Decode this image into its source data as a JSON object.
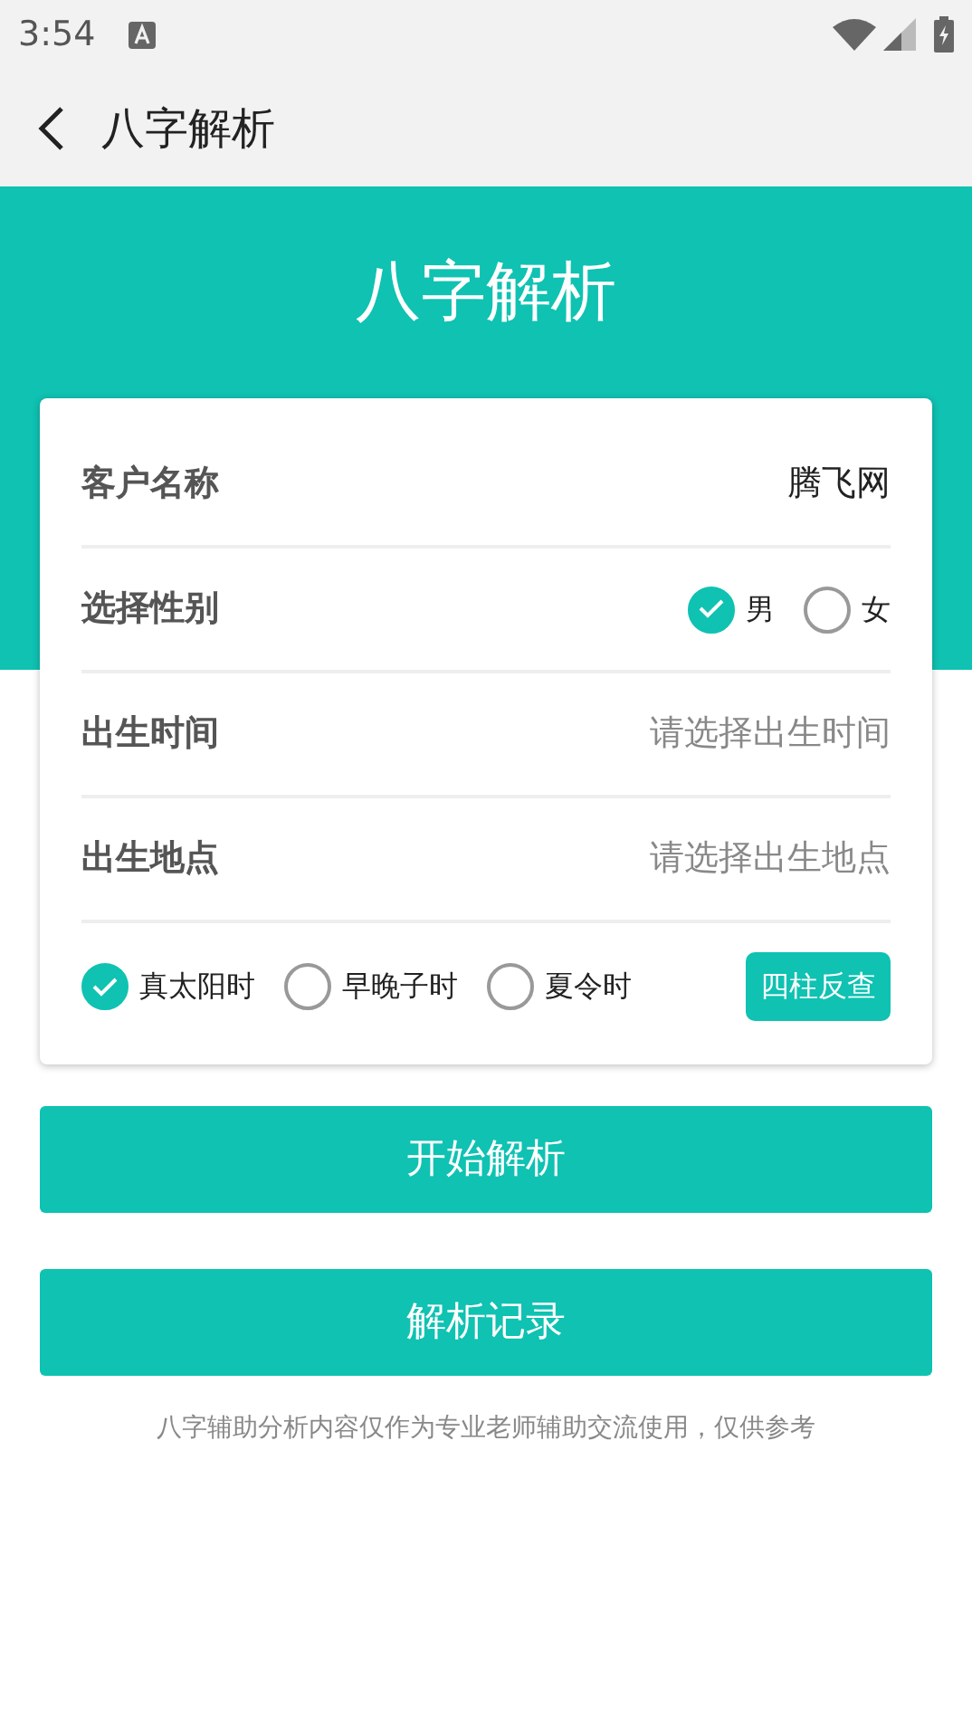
{
  "status_bar": {
    "time": "3:54"
  },
  "app_bar": {
    "title": "八字解析"
  },
  "banner": {
    "title": "八字解析"
  },
  "form": {
    "customer": {
      "label": "客户名称",
      "value": "腾飞网"
    },
    "gender": {
      "label": "选择性别",
      "options": [
        {
          "label": "男",
          "selected": true
        },
        {
          "label": "女",
          "selected": false
        }
      ]
    },
    "birth_time": {
      "label": "出生时间",
      "placeholder": "请选择出生时间"
    },
    "birth_place": {
      "label": "出生地点",
      "placeholder": "请选择出生地点"
    },
    "options": [
      {
        "label": "真太阳时",
        "checked": true
      },
      {
        "label": "早晚子时",
        "checked": false
      },
      {
        "label": "夏令时",
        "checked": false
      }
    ],
    "reverse_button": "四柱反查"
  },
  "buttons": [
    "开始解析",
    "解析记录"
  ],
  "footer_note": "八字辅助分析内容仅作为专业老师辅助交流使用，仅供参考"
}
